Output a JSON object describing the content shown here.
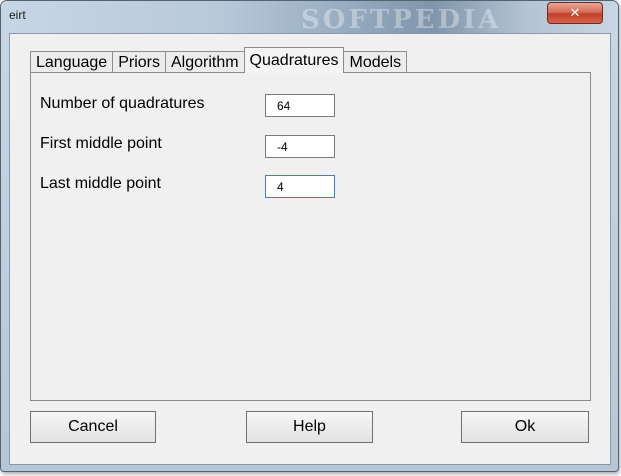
{
  "window": {
    "title": "eirt",
    "watermark": "SOFTPEDIA",
    "close_glyph": "✕"
  },
  "tabs": [
    {
      "label": "Language",
      "active": false
    },
    {
      "label": "Priors",
      "active": false
    },
    {
      "label": "Algorithm",
      "active": false
    },
    {
      "label": "Quadratures",
      "active": true
    },
    {
      "label": "Models",
      "active": false
    }
  ],
  "quadratures": {
    "num_quadratures_label": "Number of quadratures",
    "num_quadratures_value": "64",
    "first_middle_point_label": "First middle point",
    "first_middle_point_value": "-4",
    "last_middle_point_label": "Last middle point",
    "last_middle_point_value": "4"
  },
  "buttons": {
    "cancel": "Cancel",
    "help": "Help",
    "ok": "Ok"
  },
  "colors": {
    "close_button": "#c94a33",
    "focus_border": "#3d7bd6"
  }
}
